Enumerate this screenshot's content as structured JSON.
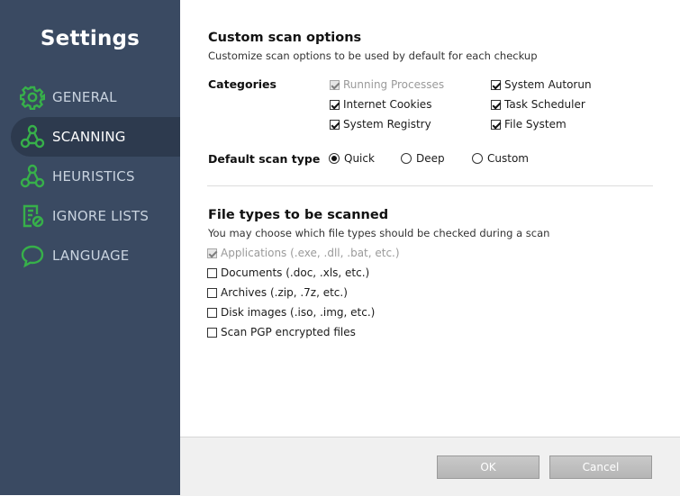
{
  "sidebar": {
    "title": "Settings",
    "accent_color": "#37b04a",
    "items": [
      {
        "label": "GENERAL",
        "icon": "gear-icon",
        "active": false
      },
      {
        "label": "SCANNING",
        "icon": "network-nodes-icon",
        "active": true
      },
      {
        "label": "HEURISTICS",
        "icon": "network-nodes-icon",
        "active": false
      },
      {
        "label": "IGNORE LISTS",
        "icon": "blocked-list-icon",
        "active": false
      },
      {
        "label": "LANGUAGE",
        "icon": "speech-bubble-icon",
        "active": false
      }
    ]
  },
  "custom_scan": {
    "title": "Custom scan options",
    "subtitle": "Customize scan options to be used by default for each checkup",
    "categories_label": "Categories",
    "categories": [
      {
        "label": "Running Processes",
        "checked": true,
        "disabled": true
      },
      {
        "label": "Internet Cookies",
        "checked": true,
        "disabled": false
      },
      {
        "label": "System Registry",
        "checked": true,
        "disabled": false
      },
      {
        "label": "System Autorun",
        "checked": true,
        "disabled": false
      },
      {
        "label": "Task Scheduler",
        "checked": true,
        "disabled": false
      },
      {
        "label": "File System",
        "checked": true,
        "disabled": false
      }
    ],
    "scan_type_label": "Default scan type",
    "scan_types": [
      {
        "label": "Quick",
        "selected": true
      },
      {
        "label": "Deep",
        "selected": false
      },
      {
        "label": "Custom",
        "selected": false
      }
    ]
  },
  "file_types": {
    "title": "File types to be scanned",
    "subtitle": "You may choose which file types should be checked during a scan",
    "items": [
      {
        "label": "Applications (.exe, .dll, .bat, etc.)",
        "checked": true,
        "disabled": true
      },
      {
        "label": "Documents (.doc, .xls, etc.)",
        "checked": false,
        "disabled": false
      },
      {
        "label": "Archives (.zip, .7z, etc.)",
        "checked": false,
        "disabled": false
      },
      {
        "label": "Disk images (.iso, .img, etc.)",
        "checked": false,
        "disabled": false
      },
      {
        "label": "Scan PGP encrypted files",
        "checked": false,
        "disabled": false
      }
    ]
  },
  "footer": {
    "ok_label": "OK",
    "cancel_label": "Cancel"
  }
}
